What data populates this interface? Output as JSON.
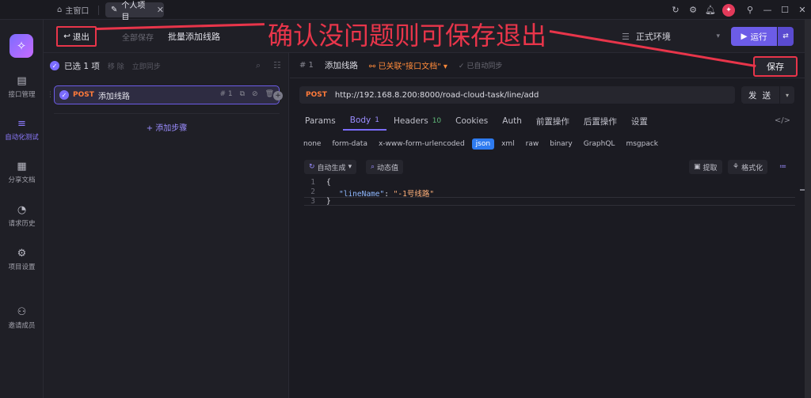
{
  "titlebar": {
    "home_label": "主窗口",
    "active_tab_label": "个人项目"
  },
  "sidebar": {
    "items": [
      {
        "label": "接口管理",
        "icon": "api-icon"
      },
      {
        "label": "自动化测试",
        "icon": "automation-icon",
        "active": true
      },
      {
        "label": "分享文档",
        "icon": "share-doc-icon"
      },
      {
        "label": "请求历史",
        "icon": "history-icon"
      },
      {
        "label": "项目设置",
        "icon": "settings-icon"
      },
      {
        "label": "邀请成员",
        "icon": "invite-icon"
      }
    ]
  },
  "toolbar": {
    "exit_label": "退出",
    "save_all_label": "全部保存",
    "title": "批量添加线路",
    "env_label": "正式环境",
    "run_label": "运行"
  },
  "annotation": {
    "text": "确认没问题则可保存退出"
  },
  "left_panel": {
    "selected_label": "已选 1 项",
    "remove_label": "移 除",
    "sync_label": "立即同步",
    "step": {
      "method": "POST",
      "name": "添加线路",
      "index": "# 1"
    },
    "add_step_label": "+ 添加步骤"
  },
  "right_panel": {
    "id_label": "# 1",
    "name": "添加线路",
    "linked_label": "已关联\"接口文档\"",
    "auto_sync_label": "已自动同步",
    "save_label": "保存",
    "method": "POST",
    "url": "http://192.168.8.200:8000/road-cloud-task/line/add",
    "send_label": "发 送",
    "tabs": [
      {
        "label": "Params",
        "count": ""
      },
      {
        "label": "Body",
        "count": "1",
        "active": true
      },
      {
        "label": "Headers",
        "count": "10"
      },
      {
        "label": "Cookies",
        "count": ""
      },
      {
        "label": "Auth",
        "count": ""
      },
      {
        "label": "前置操作",
        "count": ""
      },
      {
        "label": "后置操作",
        "count": ""
      },
      {
        "label": "设置",
        "count": ""
      }
    ],
    "body_types": [
      "none",
      "form-data",
      "x-www-form-urlencoded",
      "json",
      "xml",
      "raw",
      "binary",
      "GraphQL",
      "msgpack"
    ],
    "body_type_selected": "json",
    "editor_buttons": {
      "auto_generate": "自动生成",
      "dynamic_value": "动态值",
      "extract": "提取",
      "format": "格式化"
    },
    "code_lines": [
      "1",
      "2",
      "3"
    ],
    "code": {
      "open": "{",
      "key": "\"lineName\"",
      "colon": ": ",
      "value": "\"-1号线路\"",
      "close": "}"
    }
  },
  "colors": {
    "accent": "#7b6cff",
    "annotation_red": "#e8354a",
    "post_orange": "#ff7a3a",
    "json_blue": "#2e7bf0"
  }
}
